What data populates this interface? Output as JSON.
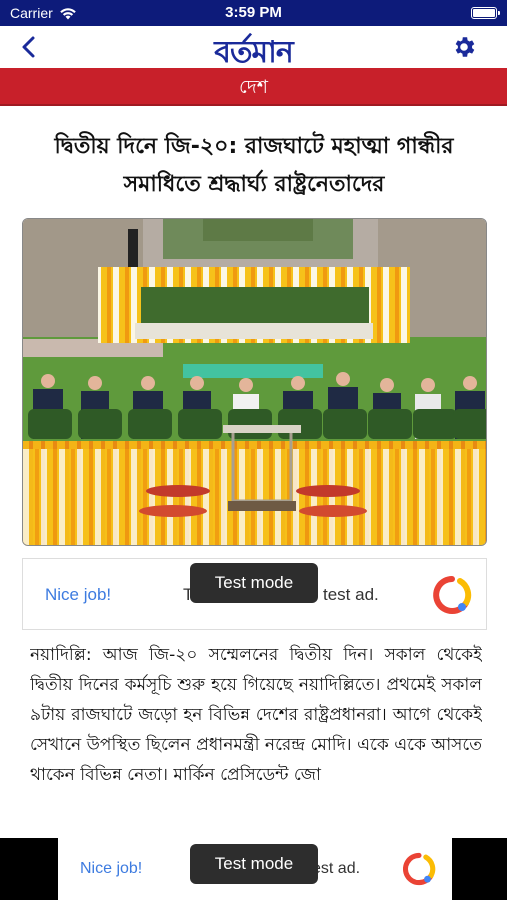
{
  "status": {
    "carrier": "Carrier",
    "time": "3:59 PM"
  },
  "header": {
    "logo": "বর্তমান",
    "back_icon": "chevron-left-icon",
    "settings_icon": "gear-icon"
  },
  "section": {
    "title": "দেশ"
  },
  "article": {
    "headline": "দ্বিতীয় দিনে জি-২০: রাজঘাটে মহাত্মা গান্ধীর সমাধিতে শ্রদ্ধার্ঘ্য রাষ্ট্রনেতাদের",
    "body": "নয়াদিল্লি: আজ জি-২০ সম্মেলনের দ্বিতীয় দিন। সকাল থেকেই দ্বিতীয় দিনের কর্মসূচি শুরু হয়ে গিয়েছে নয়াদিল্লিতে। প্রথমেই সকাল ৯টায় রাজঘাটে জড়ো হন বিভিন্ন দেশের রাষ্ট্রপ্রধানরা। আগে থেকেই সেখানে উপস্থিত ছিলেন প্রধানমন্ত্রী নরেন্দ্র মোদি। একে একে আসতে থাকেন বিভিন্ন নেতা। মার্কিন প্রেসিডেন্ট জো"
  },
  "ad_inline": {
    "nice": "Nice job!",
    "text_start": "T",
    "text_end": "test ad.",
    "badge": "Test mode"
  },
  "ad_banner": {
    "nice": "Nice job!",
    "text_end": "est ad.",
    "badge": "Test mode"
  },
  "colors": {
    "status_bar": "#0d1b7a",
    "brand": "#1a2a9a",
    "section_red": "#c8202a",
    "ad_blue": "#3d7be0"
  }
}
